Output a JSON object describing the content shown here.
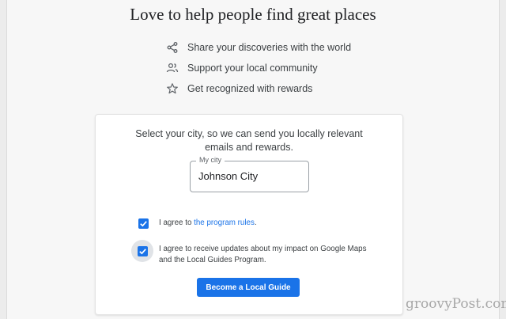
{
  "headline": "Love to help people find great places",
  "benefits": [
    {
      "icon": "share-icon",
      "text": "Share your discoveries with the world"
    },
    {
      "icon": "people-icon",
      "text": "Support your local community"
    },
    {
      "icon": "star-icon",
      "text": "Get recognized with rewards"
    }
  ],
  "signup": {
    "prompt_line1": "Select your city, so we can send you locally relevant",
    "prompt_line2": "emails and rewards.",
    "city_label": "My city",
    "city_value": "Johnson City",
    "agree_rules_prefix": "I agree to ",
    "agree_rules_link": "the program rules",
    "agree_rules_suffix": ".",
    "rules_checked": true,
    "agree_updates_line1": "I agree to receive updates about my impact on Google Maps",
    "agree_updates_line2": "and the Local Guides Program.",
    "updates_checked": true,
    "button_label": "Become a Local Guide"
  },
  "watermark": "groovyPost.com",
  "colors": {
    "accent": "#1a73e8",
    "text": "#3c4043",
    "border": "#9aa0a6"
  }
}
